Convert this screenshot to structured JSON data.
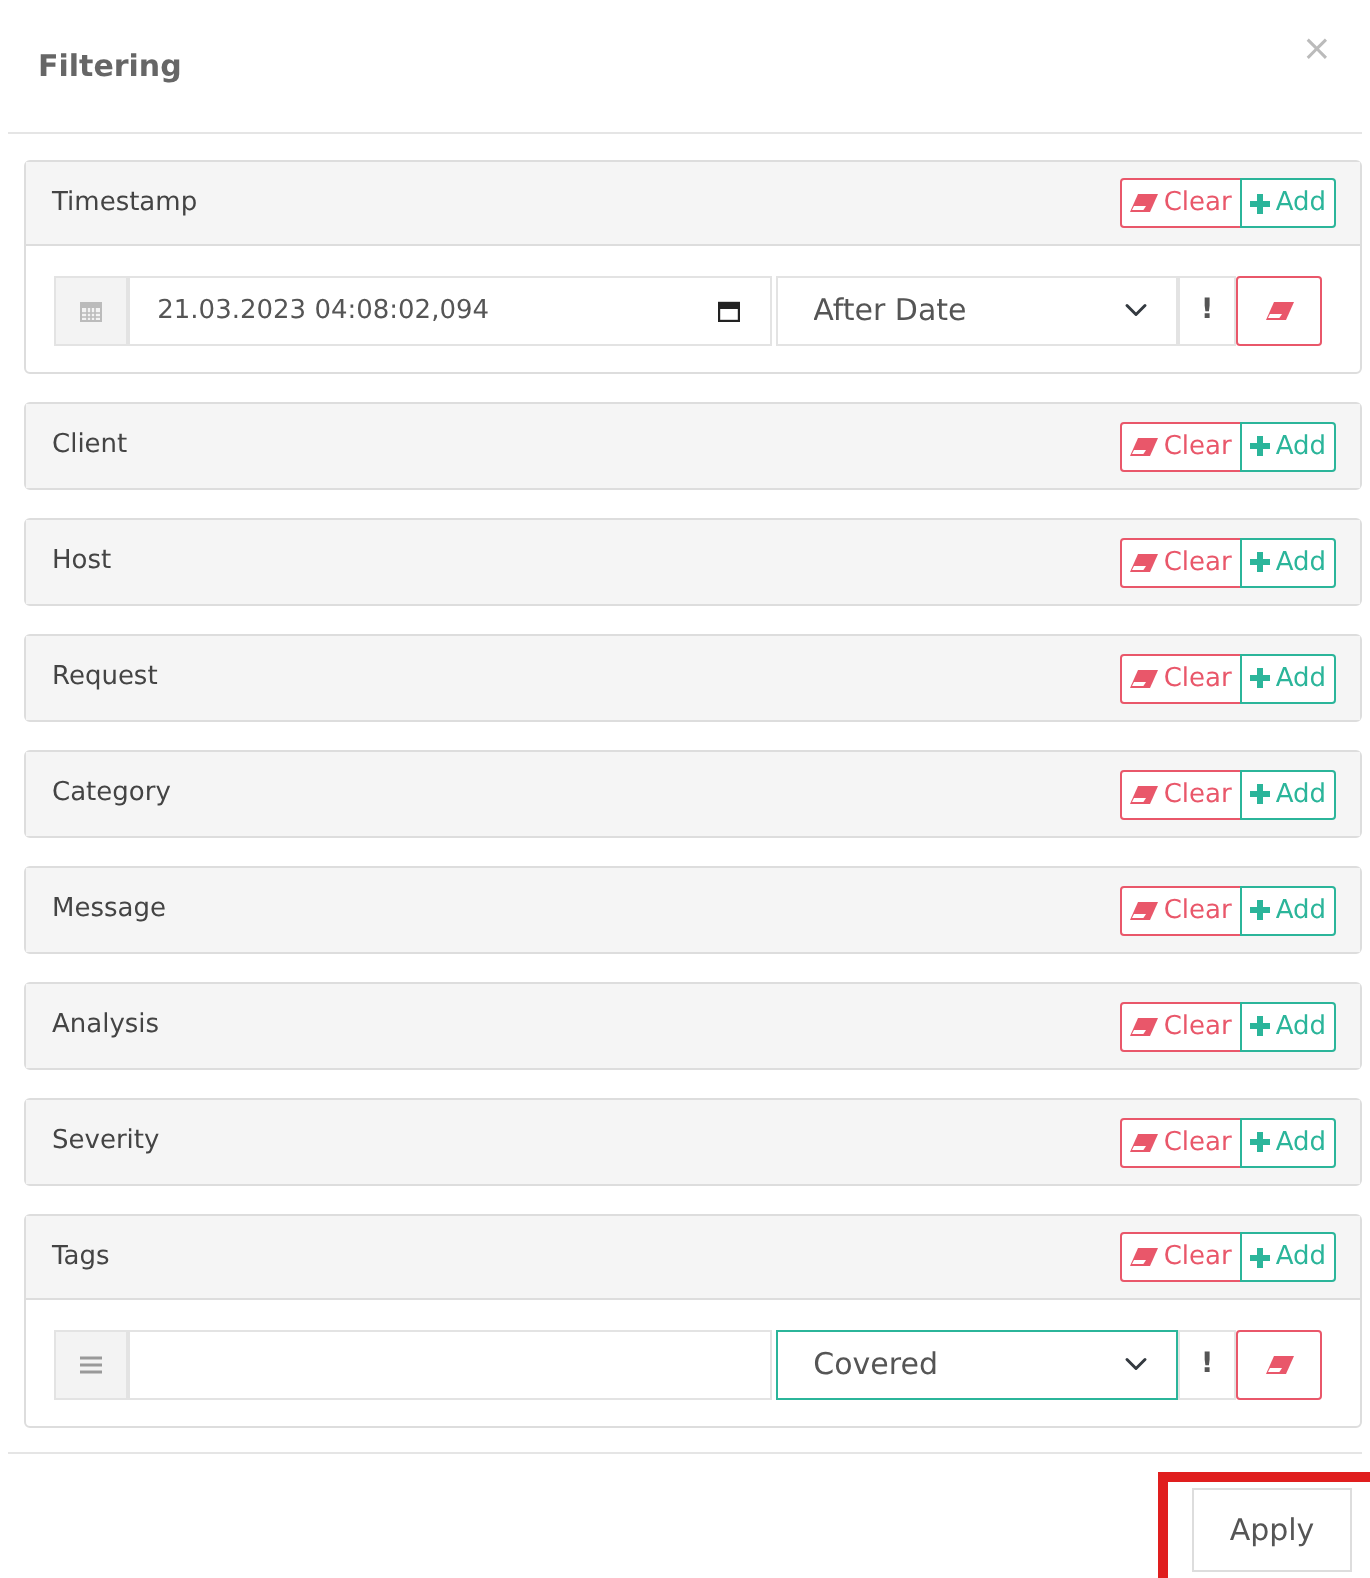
{
  "dialog": {
    "title": "Filtering",
    "close": "×"
  },
  "filters": [
    {
      "label": "Timestamp",
      "clear": "Clear",
      "add": "Add",
      "conditions": [
        {
          "kind": "date",
          "value": "21.03.2023 04:08:02,094",
          "operator": "After Date",
          "operator_highlighted": false,
          "negate": "!"
        }
      ]
    },
    {
      "label": "Client",
      "clear": "Clear",
      "add": "Add"
    },
    {
      "label": "Host",
      "clear": "Clear",
      "add": "Add"
    },
    {
      "label": "Request",
      "clear": "Clear",
      "add": "Add"
    },
    {
      "label": "Category",
      "clear": "Clear",
      "add": "Add"
    },
    {
      "label": "Message",
      "clear": "Clear",
      "add": "Add"
    },
    {
      "label": "Analysis",
      "clear": "Clear",
      "add": "Add"
    },
    {
      "label": "Severity",
      "clear": "Clear",
      "add": "Add"
    },
    {
      "label": "Tags",
      "clear": "Clear",
      "add": "Add",
      "conditions": [
        {
          "kind": "list",
          "operator": "Covered",
          "operator_highlighted": true,
          "negate": "!"
        }
      ]
    }
  ],
  "footer": {
    "apply": "Apply",
    "apply_highlighted": true
  }
}
